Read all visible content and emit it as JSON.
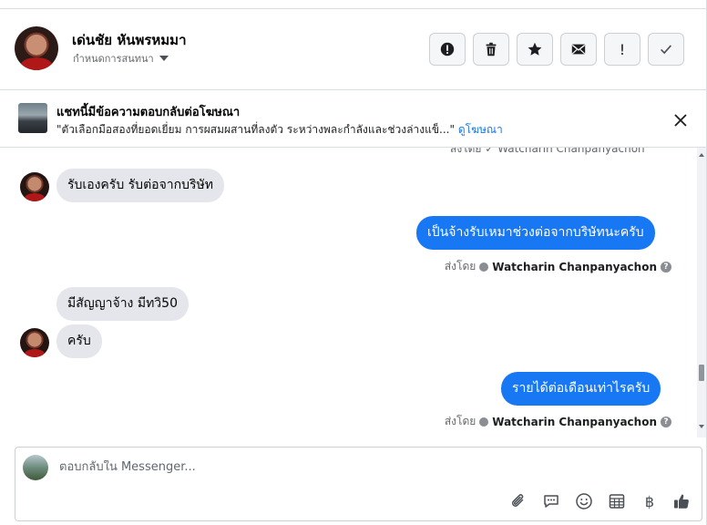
{
  "header": {
    "contact_name": "เด่นชัย หันพรหมมา",
    "status_label": "กำหนดการสนทนา",
    "actions": [
      {
        "name": "report-icon",
        "label": ""
      },
      {
        "name": "trash-icon",
        "label": ""
      },
      {
        "name": "star-icon",
        "label": ""
      },
      {
        "name": "envelope-icon",
        "label": ""
      },
      {
        "name": "exclamation-icon",
        "label": "!"
      },
      {
        "name": "check-icon",
        "label": "✓"
      }
    ]
  },
  "ad_banner": {
    "title": "แชทนี้มีข้อความตอบกลับต่อโฆษณา",
    "description": "\"ตัวเลือกมือสองที่ยอดเยี่ยม การผสมผสานที่ลงตัว ระหว่างพละกำลังและช่วงล่างแข็...\"",
    "link": "ดูโฆษณา"
  },
  "messages": {
    "clipped_sender": "ส่งโดย ✓ Watcharin Chanpanyachon",
    "items": [
      {
        "direction": "in",
        "text": "รับเองครับ รับต่อจากบริษัท"
      },
      {
        "direction": "out",
        "text": "เป็นจ้างรับเหมาช่วงต่อจากบริษัทนะครับ",
        "sent_prefix": "ส่งโดย",
        "sent_by": "Watcharin Chanpanyachon"
      },
      {
        "direction": "in",
        "text": "มีสัญญาจ้าง มีทวิ50"
      },
      {
        "direction": "in",
        "text": "ครับ"
      },
      {
        "direction": "out",
        "text": "รายได้ต่อเดือนเท่าไรครับ",
        "sent_prefix": "ส่งโดย",
        "sent_by": "Watcharin Chanpanyachon"
      }
    ]
  },
  "composer": {
    "placeholder": "ตอบกลับใน Messenger...",
    "icons": [
      "paperclip-icon",
      "saved-reply-icon",
      "emoji-icon",
      "table-icon",
      "baht-icon",
      "thumbs-up-icon"
    ],
    "baht_symbol": "฿"
  },
  "colors": {
    "accent": "#1877f2",
    "bubble_in": "#e4e6eb",
    "secondary_text": "#65676b"
  }
}
